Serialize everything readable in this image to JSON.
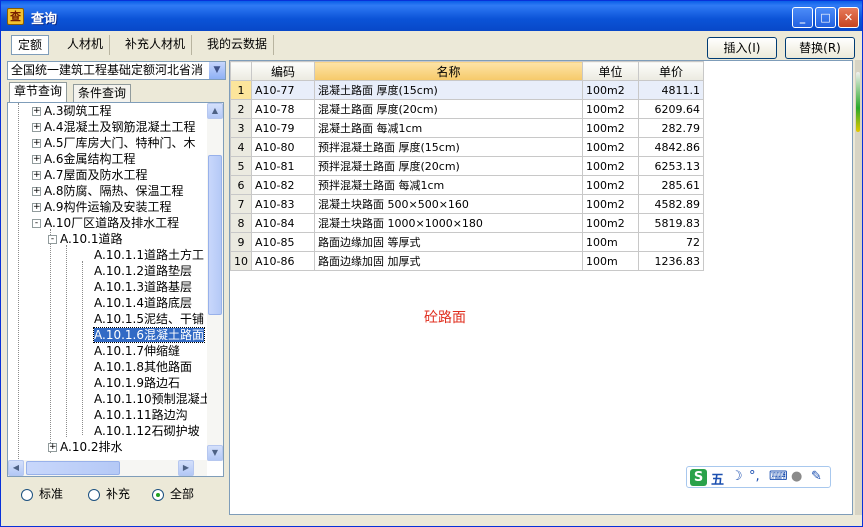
{
  "window": {
    "title": "查询",
    "title_icon_glyph": "查"
  },
  "tabs": [
    {
      "label": "定额",
      "active": true
    },
    {
      "label": "人材机",
      "active": false
    },
    {
      "label": "补充人材机",
      "active": false
    },
    {
      "label": "我的云数据",
      "active": false
    }
  ],
  "actions": {
    "insert_label": "插入(I)",
    "replace_label": "替换(R)"
  },
  "left": {
    "library_select": "全国统一建筑工程基础定额河北省消",
    "subtabs": [
      {
        "label": "章节查询",
        "active": true
      },
      {
        "label": "条件查询",
        "active": false
      }
    ],
    "tree": [
      {
        "label": "A.3砌筑工程",
        "level": 1,
        "expander": "+"
      },
      {
        "label": "A.4混凝土及钢筋混凝土工程",
        "level": 1,
        "expander": "+"
      },
      {
        "label": "A.5厂库房大门、特种门、木",
        "level": 1,
        "expander": "+"
      },
      {
        "label": "A.6金属结构工程",
        "level": 1,
        "expander": "+"
      },
      {
        "label": "A.7屋面及防水工程",
        "level": 1,
        "expander": "+"
      },
      {
        "label": "A.8防腐、隔热、保温工程",
        "level": 1,
        "expander": "+"
      },
      {
        "label": "A.9构件运输及安装工程",
        "level": 1,
        "expander": "+"
      },
      {
        "label": "A.10厂区道路及排水工程",
        "level": 1,
        "expander": "-"
      },
      {
        "label": "A.10.1道路",
        "level": 2,
        "expander": "-"
      },
      {
        "label": "A.10.1.1道路土方工",
        "level": 3,
        "expander": ""
      },
      {
        "label": "A.10.1.2道路垫层",
        "level": 3,
        "expander": ""
      },
      {
        "label": "A.10.1.3道路基层",
        "level": 3,
        "expander": ""
      },
      {
        "label": "A.10.1.4道路底层",
        "level": 3,
        "expander": ""
      },
      {
        "label": "A.10.1.5泥结、干铺",
        "level": 3,
        "expander": ""
      },
      {
        "label": "A.10.1.6混凝土路面",
        "level": 3,
        "expander": "",
        "selected": true
      },
      {
        "label": "A.10.1.7伸缩缝",
        "level": 3,
        "expander": ""
      },
      {
        "label": "A.10.1.8其他路面",
        "level": 3,
        "expander": ""
      },
      {
        "label": "A.10.1.9路边石",
        "level": 3,
        "expander": ""
      },
      {
        "label": "A.10.1.10预制混凝土",
        "level": 3,
        "expander": ""
      },
      {
        "label": "A.10.1.11路边沟",
        "level": 3,
        "expander": ""
      },
      {
        "label": "A.10.1.12石砌护坡",
        "level": 3,
        "expander": ""
      },
      {
        "label": "A.10.2排水",
        "level": 2,
        "expander": "+"
      }
    ],
    "radios": [
      {
        "label": "标准",
        "checked": false
      },
      {
        "label": "补充",
        "checked": false
      },
      {
        "label": "全部",
        "checked": true
      }
    ]
  },
  "grid": {
    "headers": {
      "code": "编码",
      "name": "名称",
      "unit": "单位",
      "price": "单价"
    },
    "rows": [
      {
        "n": "1",
        "code": "A10-77",
        "name": "混凝土路面 厚度(15cm)",
        "unit": "100m2",
        "price": "4811.1"
      },
      {
        "n": "2",
        "code": "A10-78",
        "name": "混凝土路面 厚度(20cm)",
        "unit": "100m2",
        "price": "6209.64"
      },
      {
        "n": "3",
        "code": "A10-79",
        "name": "混凝土路面 每减1cm",
        "unit": "100m2",
        "price": "282.79"
      },
      {
        "n": "4",
        "code": "A10-80",
        "name": "预拌混凝土路面 厚度(15cm)",
        "unit": "100m2",
        "price": "4842.86"
      },
      {
        "n": "5",
        "code": "A10-81",
        "name": "预拌混凝土路面 厚度(20cm)",
        "unit": "100m2",
        "price": "6253.13"
      },
      {
        "n": "6",
        "code": "A10-82",
        "name": "预拌混凝土路面 每减1cm",
        "unit": "100m2",
        "price": "285.61"
      },
      {
        "n": "7",
        "code": "A10-83",
        "name": "混凝土块路面 500×500×160",
        "unit": "100m2",
        "price": "4582.89"
      },
      {
        "n": "8",
        "code": "A10-84",
        "name": "混凝土块路面 1000×1000×180",
        "unit": "100m2",
        "price": "5819.83"
      },
      {
        "n": "9",
        "code": "A10-85",
        "name": "路面边缘加固 等厚式",
        "unit": "100m",
        "price": "72"
      },
      {
        "n": "10",
        "code": "A10-86",
        "name": "路面边缘加固 加厚式",
        "unit": "100m",
        "price": "1236.83"
      }
    ],
    "annotation": "砼路面"
  },
  "ime": {
    "logo": "S",
    "mode": "五",
    "moon": "☽",
    "punct": "°,",
    "keyboard": "⌨",
    "user": "●",
    "tool": "✎"
  },
  "colors": {
    "title_bar": "#0b53d7",
    "selection": "#316ac5",
    "annotation": "#e03020"
  }
}
